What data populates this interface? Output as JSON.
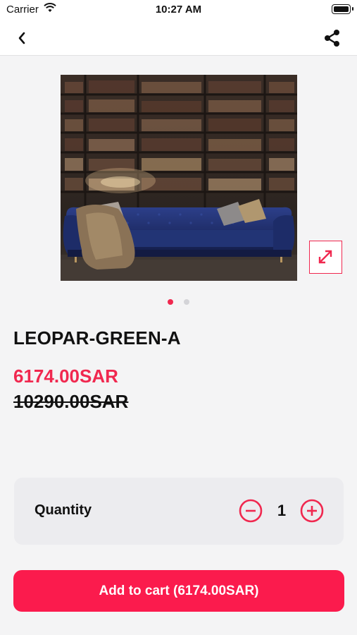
{
  "status_bar": {
    "carrier": "Carrier",
    "time": "10:27 AM"
  },
  "nav": {
    "back_icon": "chevron-left-icon",
    "share_icon": "share-icon"
  },
  "gallery": {
    "image_description_icon": "sofa-product-photo",
    "expand_icon": "expand-arrows-icon",
    "page_count": 2,
    "active_page": 1
  },
  "product": {
    "name": "LEOPAR-GREEN-A",
    "price_current": "6174.00SAR",
    "price_old": "10290.00SAR"
  },
  "quantity": {
    "label": "Quantity",
    "value": "1"
  },
  "cart_button": {
    "label": "Add to cart (6174.00SAR)"
  },
  "colors": {
    "accent": "#f0284f",
    "button": "#fb1b4d"
  }
}
